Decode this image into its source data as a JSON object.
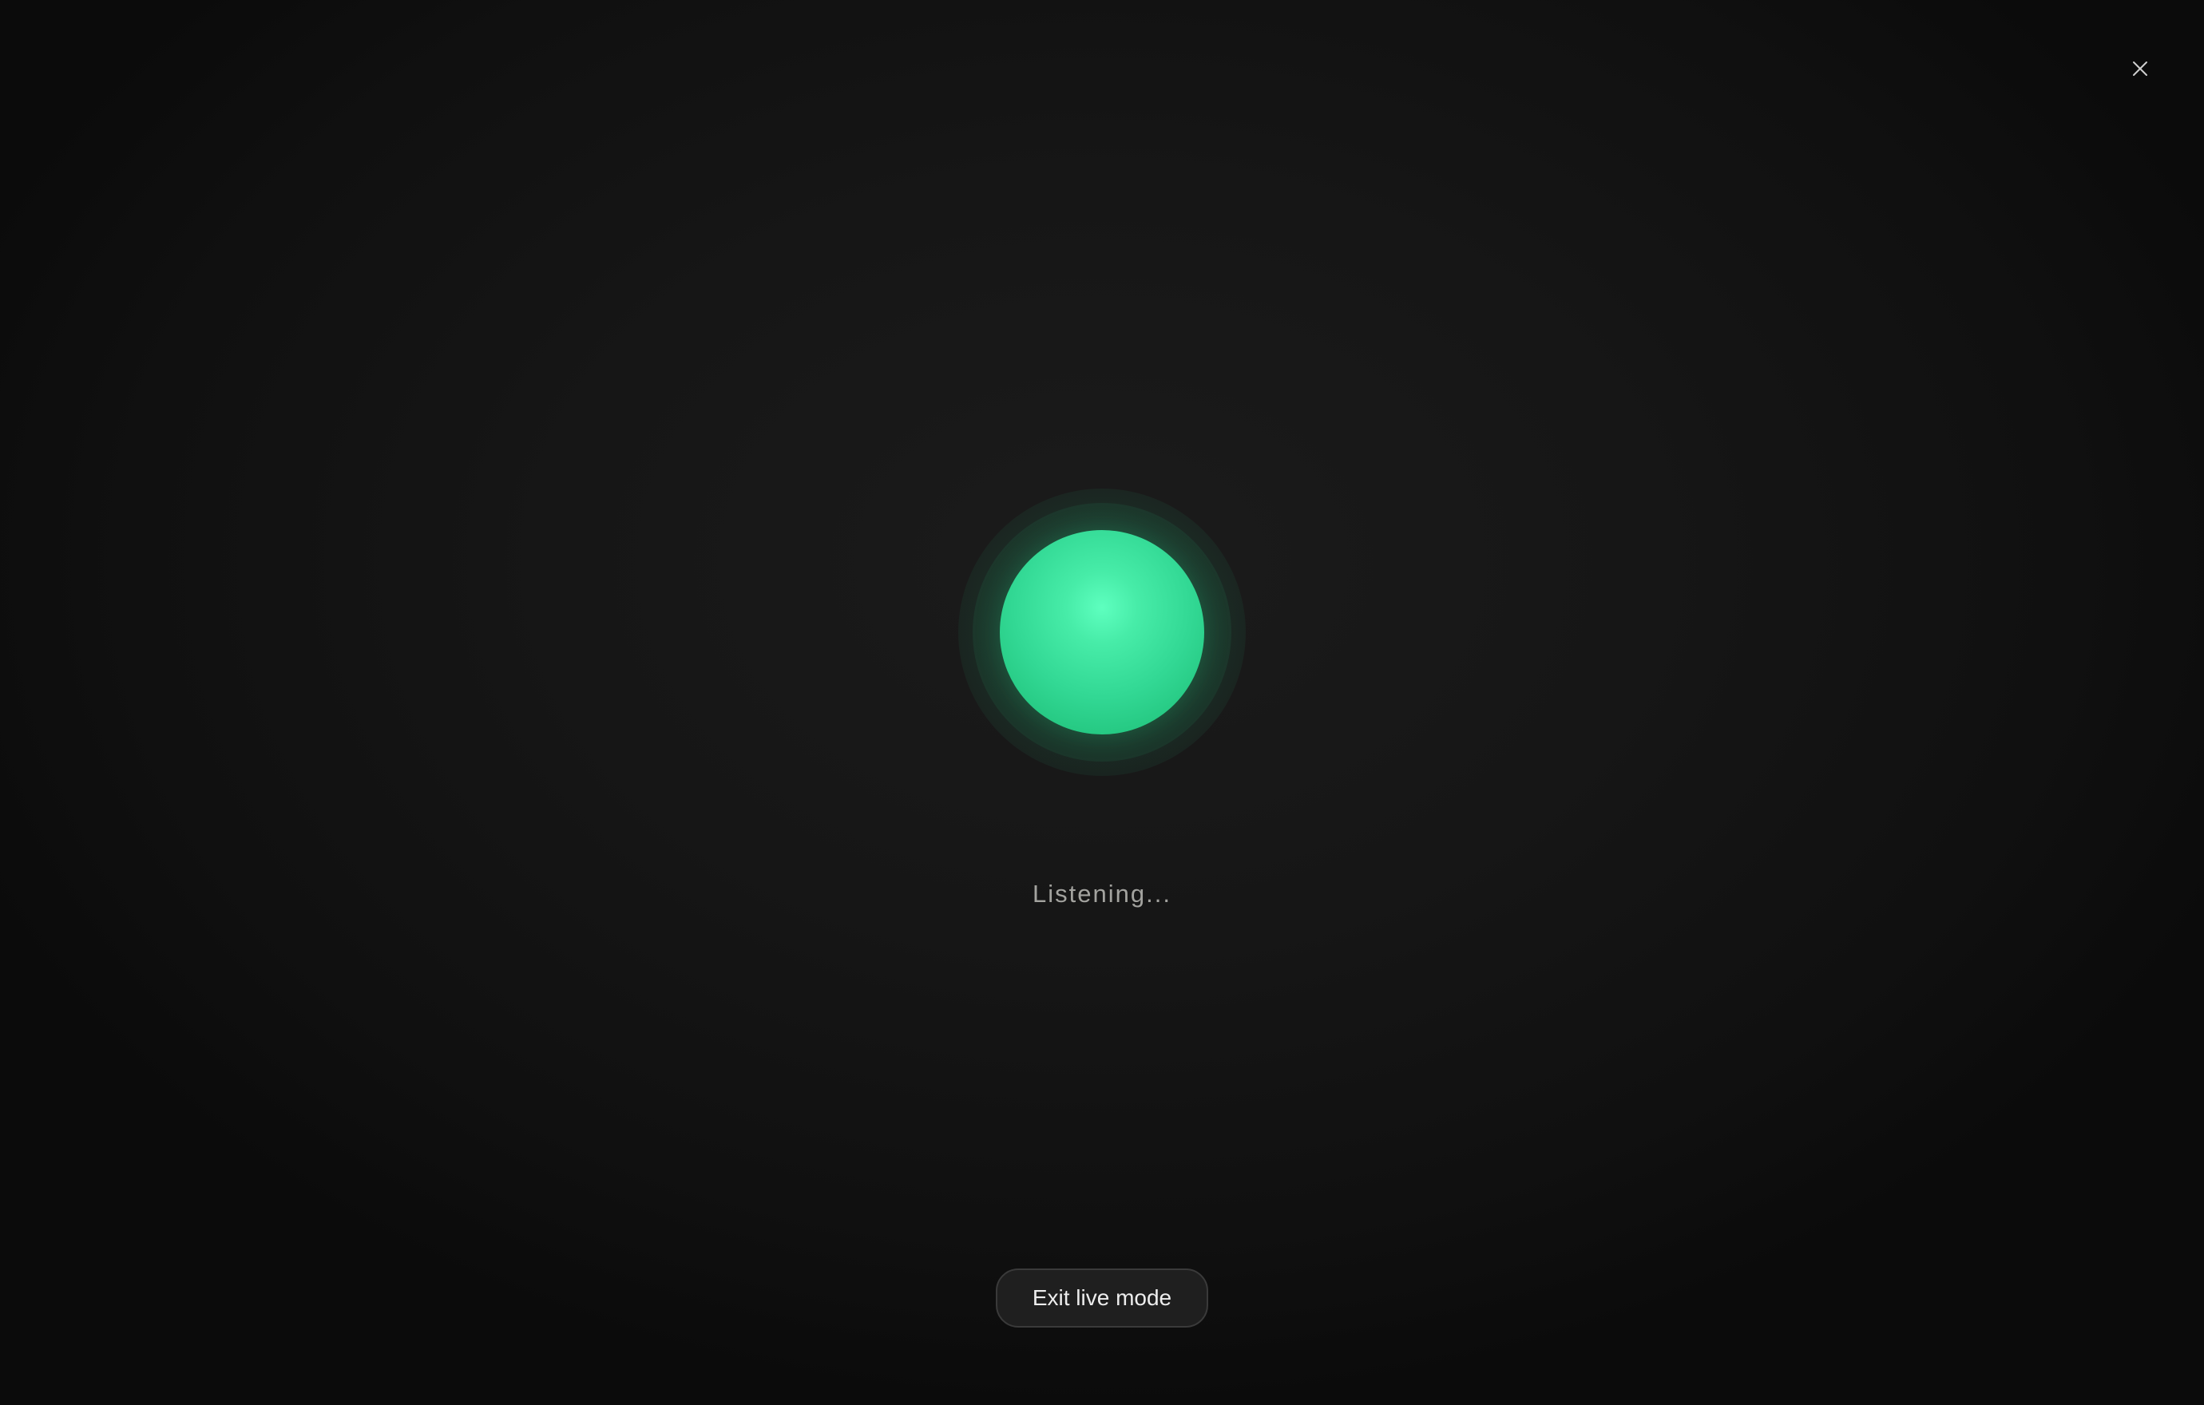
{
  "header": {
    "close_icon": "close-icon"
  },
  "orb": {
    "color": "#3ee0a0"
  },
  "status": {
    "text": "Listening..."
  },
  "footer": {
    "exit_label": "Exit live mode"
  }
}
